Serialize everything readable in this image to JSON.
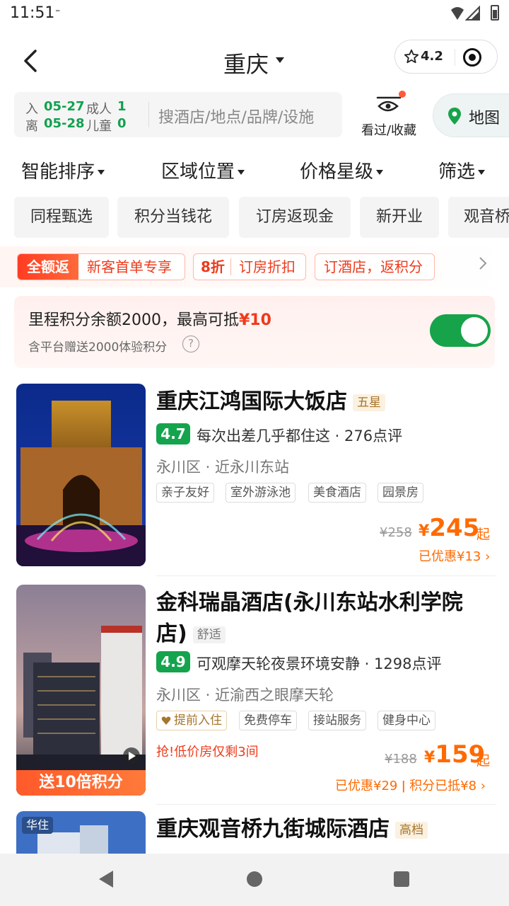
{
  "status": {
    "time": "11:51",
    "icon": "signal-dot"
  },
  "header": {
    "city": "重庆",
    "rating": "4.2"
  },
  "search": {
    "checkin_label": "入",
    "checkin_date": "05-27",
    "checkout_label": "离",
    "checkout_date": "05-28",
    "adult_label": "成人",
    "adult_count": "1",
    "child_label": "儿童",
    "child_count": "0",
    "placeholder": "搜酒店/地点/品牌/设施",
    "favorites_label": "看过/收藏",
    "map_label": "地图"
  },
  "sort": [
    "智能排序",
    "区域位置",
    "价格星级",
    "筛选"
  ],
  "chips": [
    "同程甄选",
    "积分当钱花",
    "订房返现金",
    "新开业",
    "观音桥"
  ],
  "promos": {
    "full_badge": "全额返",
    "full_text": "新客首单专享",
    "discount_badge": "8折",
    "discount_text": "订房折扣",
    "points_text": "订酒店，返积分"
  },
  "points_card": {
    "title_prefix": "里程积分余额2000，最高可抵",
    "title_amount": "¥10",
    "subtitle": "含平台赠送2000体验积分",
    "help": "?",
    "toggle_on": true
  },
  "hotels": [
    {
      "name": "重庆江鸿国际大饭店",
      "grade": "五星",
      "score": "4.7",
      "review": "每次出差几乎都住这 · 276点评",
      "location": "永川区 · 近永川东站",
      "tags": [
        "亲子友好",
        "室外游泳池",
        "美食酒店",
        "园景房"
      ],
      "old_price": "¥258",
      "currency": "¥",
      "price": "245",
      "suffix": "起",
      "saving": "已优惠¥13"
    },
    {
      "name_line1": "金科瑞晶酒店(永川东站水利学院",
      "name_line2": "店)",
      "grade": "舒适",
      "score": "4.9",
      "review": "可观摩天轮夜景环境安静 · 1298点评",
      "location": "永川区 · 近渝西之眼摩天轮",
      "tags": [
        "提前入住",
        "免费停车",
        "接站服务",
        "健身中心"
      ],
      "urgency": "抢!低价房仅剩3间",
      "old_price": "¥188",
      "currency": "¥",
      "price": "159",
      "suffix": "起",
      "saving": "已优惠¥29",
      "points_saving": "积分已抵¥8",
      "image_banner": "送10倍积分"
    },
    {
      "name": "重庆观音桥九街城际酒店",
      "grade": "高档",
      "brand_badge": "华住"
    }
  ]
}
